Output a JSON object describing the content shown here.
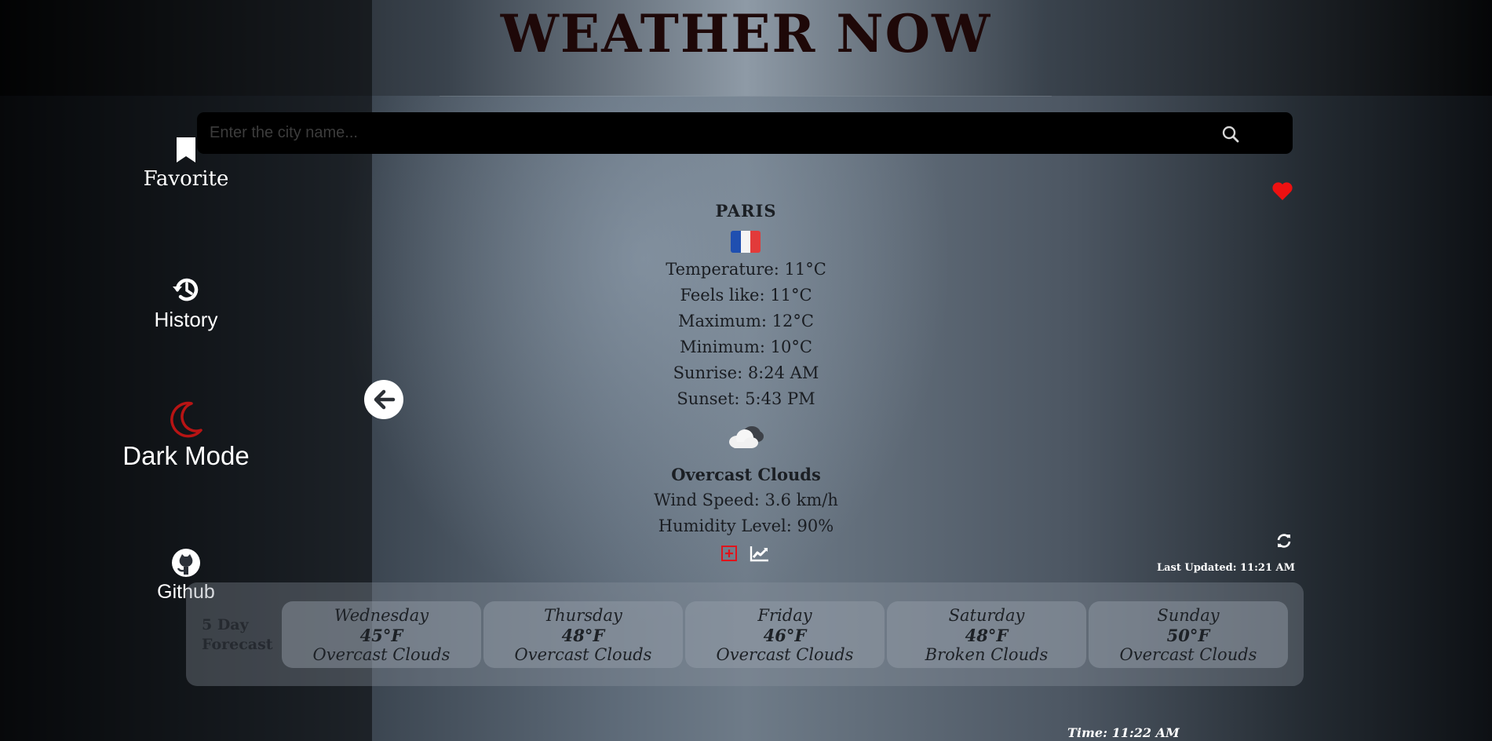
{
  "app": {
    "title": "WEATHER NOW"
  },
  "sidebar": {
    "items": [
      {
        "label": "Favorite",
        "icon": "bookmark-icon"
      },
      {
        "label": "History",
        "icon": "history-icon"
      },
      {
        "label": "Dark Mode",
        "icon": "moon-icon"
      },
      {
        "label": "Github",
        "icon": "github-icon"
      }
    ]
  },
  "search": {
    "placeholder": "Enter the city name...",
    "value": ""
  },
  "weather": {
    "city": "PARIS",
    "flag": "france-flag",
    "temperature": "Temperature: 11°C",
    "feels_like": "Feels like: 11°C",
    "maximum": "Maximum: 12°C",
    "minimum": "Minimum: 10°C",
    "sunrise": "Sunrise: 8:24 AM",
    "sunset": "Sunset: 5:43 PM",
    "condition_icon": "cloud-icon",
    "description": "Overcast Clouds",
    "wind_speed": "Wind Speed: 3.6 km/h",
    "humidity": "Humidity Level: 90%",
    "last_updated": "Last Updated: 11:21 AM"
  },
  "forecast": {
    "label_line1": "5 Day",
    "label_line2": "Forecast",
    "days": [
      {
        "day": "Wednesday",
        "temp": "45°F",
        "desc": "Overcast Clouds"
      },
      {
        "day": "Thursday",
        "temp": "48°F",
        "desc": "Overcast Clouds"
      },
      {
        "day": "Friday",
        "temp": "46°F",
        "desc": "Overcast Clouds"
      },
      {
        "day": "Saturday",
        "temp": "48°F",
        "desc": "Broken Clouds"
      },
      {
        "day": "Sunday",
        "temp": "50°F",
        "desc": "Overcast Clouds"
      }
    ]
  },
  "footer": {
    "time": "Time: 11:22 AM"
  },
  "colors": {
    "accent": "#e0141c",
    "dark_mode_icon": "#b81414",
    "heart": "#ee1111"
  }
}
